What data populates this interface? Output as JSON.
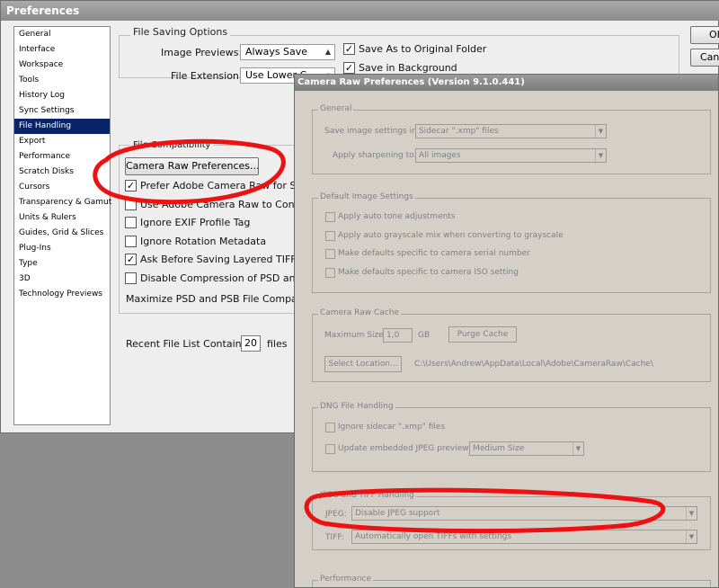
{
  "preferences": {
    "title": "Preferences",
    "sidebar": [
      {
        "label": "General",
        "selected": false
      },
      {
        "label": "Interface",
        "selected": false
      },
      {
        "label": "Workspace",
        "selected": false
      },
      {
        "label": "Tools",
        "selected": false
      },
      {
        "label": "History Log",
        "selected": false
      },
      {
        "label": "Sync Settings",
        "selected": false
      },
      {
        "label": "File Handling",
        "selected": true
      },
      {
        "label": "Export",
        "selected": false
      },
      {
        "label": "Performance",
        "selected": false
      },
      {
        "label": "Scratch Disks",
        "selected": false
      },
      {
        "label": "Cursors",
        "selected": false
      },
      {
        "label": "Transparency & Gamut",
        "selected": false
      },
      {
        "label": "Units & Rulers",
        "selected": false
      },
      {
        "label": "Guides, Grid & Slices",
        "selected": false
      },
      {
        "label": "Plug-Ins",
        "selected": false
      },
      {
        "label": "Type",
        "selected": false
      },
      {
        "label": "3D",
        "selected": false
      },
      {
        "label": "Technology Previews",
        "selected": false
      }
    ],
    "file_saving": {
      "legend": "File Saving Options",
      "image_previews_label": "Image Previews:",
      "image_previews_value": "Always Save",
      "file_extension_label": "File Extension:",
      "file_extension_value": "Use Lower C",
      "save_as_original": "Save As to Original Folder",
      "save_in_background": "Save in Background"
    },
    "file_compat": {
      "legend": "File Compatibility",
      "camera_raw_button": "Camera Raw Preferences...",
      "options": [
        {
          "label": "Prefer Adobe Camera Raw for Suppo",
          "checked": true
        },
        {
          "label": "Use Adobe Camera Raw to Convert D",
          "checked": false
        },
        {
          "label": "Ignore EXIF Profile Tag",
          "checked": false
        },
        {
          "label": "Ignore Rotation Metadata",
          "checked": false
        },
        {
          "label": "Ask Before Saving Layered TIFF File",
          "checked": true
        },
        {
          "label": "Disable Compression of PSD and PS",
          "checked": false
        }
      ],
      "maximize_label": "Maximize PSD and PSB File Compatibilit"
    },
    "recent": {
      "label": "Recent File List Contains:",
      "value": "20",
      "suffix": "files"
    },
    "ok_button": "OK",
    "cancel_button": "Canc"
  },
  "camera_raw": {
    "title": "Camera Raw Preferences  (Version 9.1.0.441)",
    "general": {
      "legend": "General",
      "save_label": "Save image settings in:",
      "save_value": "Sidecar \".xmp\" files",
      "sharpen_label": "Apply sharpening to:",
      "sharpen_value": "All images"
    },
    "defaults": {
      "legend": "Default Image Settings",
      "options": [
        "Apply auto tone adjustments",
        "Apply auto grayscale mix when converting to grayscale",
        "Make defaults specific to camera serial number",
        "Make defaults specific to camera ISO setting"
      ]
    },
    "cache": {
      "legend": "Camera Raw Cache",
      "max_label": "Maximum Size:",
      "max_value": "1,0",
      "unit": "GB",
      "purge": "Purge Cache",
      "select": "Select Location...",
      "path": "C:\\Users\\Andrew\\AppData\\Local\\Adobe\\CameraRaw\\Cache\\"
    },
    "dng": {
      "legend": "DNG File Handling",
      "ignore": "Ignore sidecar \".xmp\" files",
      "update": "Update embedded JPEG previews:",
      "preview_value": "Medium Size"
    },
    "jpeg_tiff": {
      "legend": "JPEG and TIFF Handling",
      "jpeg_label": "JPEG:",
      "jpeg_value": "Disable JPEG support",
      "tiff_label": "TIFF:",
      "tiff_value": "Automatically open TIFFs with settings"
    },
    "performance": {
      "legend": "Performance"
    }
  },
  "colors": {
    "selection": "#0a246a",
    "annotation": "#ee1111",
    "dialog": "#d4d0c8"
  }
}
